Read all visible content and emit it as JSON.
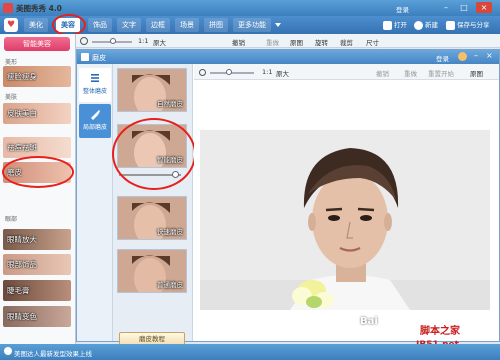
{
  "app": {
    "title": "美图秀秀 4.0"
  },
  "titlebar": {
    "login": "登录"
  },
  "main_tabs": [
    "美化",
    "美容",
    "饰品",
    "文字",
    "边框",
    "场景",
    "拼图",
    "更多功能"
  ],
  "toolbar_right": {
    "open": "打开",
    "new": "新建",
    "save": "保存与分享"
  },
  "left": {
    "smart_button": "智能美容",
    "sections": {
      "beauty": "美形",
      "skin": "美肤",
      "eyes": "眼部"
    },
    "items": [
      "瘦脸瘦身",
      "皮肤美白",
      "祛痘祛斑",
      "磨皮",
      "眼睛放大",
      "眼部饰品",
      "睫毛膏",
      "眼睛变色"
    ]
  },
  "subtoolbar": {
    "ratio": "1:1",
    "original": "原大",
    "undo": "撤销",
    "redo": "重做",
    "origin": "原图",
    "rotate": "旋转",
    "crop": "裁剪",
    "size": "尺寸"
  },
  "dialog": {
    "title": "磨皮",
    "login": "登录",
    "side_tabs": [
      "整体磨皮",
      "局部磨皮"
    ],
    "thumbs": [
      "自然磨皮",
      "智能磨皮",
      "快速磨皮",
      "普通磨皮"
    ],
    "bottom_button": "磨皮教程",
    "canvas": {
      "ratio": "1:1",
      "original": "原大",
      "undo": "撤销",
      "redo": "重做",
      "reset": "重置开始",
      "origin": "原图"
    }
  },
  "status": {
    "text": "美图达人最新发型效果上线"
  },
  "watermark": {
    "text": "Bai",
    "site": "脚本之家",
    "url": "JB51.net"
  },
  "colors": {
    "accent": "#3b7fbf",
    "pink": "#de3e69",
    "annotation": "#e8201b"
  }
}
